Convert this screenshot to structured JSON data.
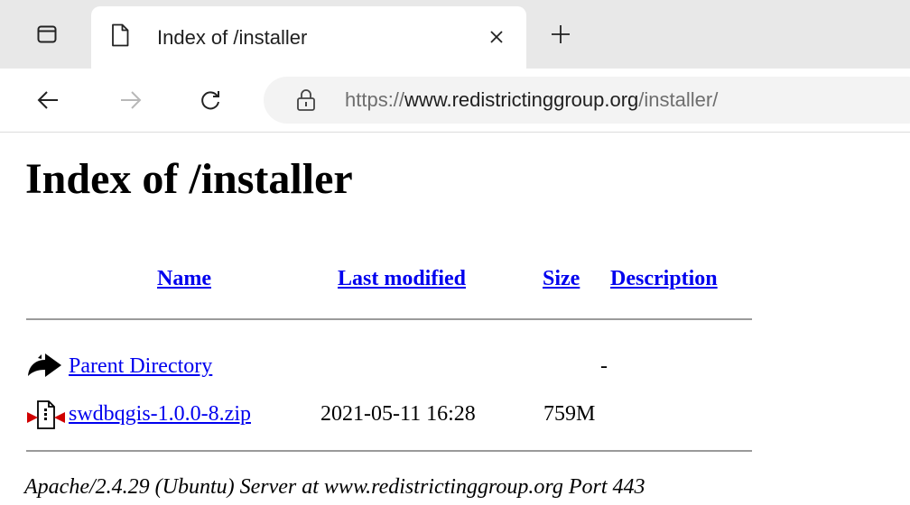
{
  "browser": {
    "tab": {
      "title": "Index of /installer"
    },
    "address": {
      "protocol": "https://",
      "host": "www.redistrictinggroup.org",
      "path": "/installer/"
    },
    "icons": {
      "tab_actions": "tab-actions-icon",
      "page": "page-icon",
      "close": "close-icon",
      "new_tab": "plus-icon",
      "back": "back-arrow-icon",
      "forward": "forward-arrow-icon",
      "reload": "reload-icon",
      "lock": "lock-icon"
    }
  },
  "page": {
    "heading": "Index of /installer",
    "columns": {
      "name": "Name",
      "last_modified": "Last modified",
      "size": "Size",
      "description": "Description"
    },
    "rows": [
      {
        "icon": "back-folder-icon",
        "name": "Parent Directory",
        "modified": "",
        "size": "-"
      },
      {
        "icon": "compressed-file-icon",
        "name": "swdbqgis-1.0.0-8.zip",
        "modified": "2021-05-11 16:28",
        "size": "759M"
      }
    ],
    "footer": "Apache/2.4.29 (Ubuntu) Server at www.redistrictinggroup.org Port 443"
  }
}
